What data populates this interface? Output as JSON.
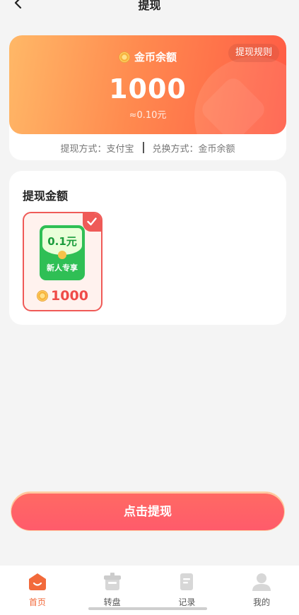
{
  "nav": {
    "title": "提现"
  },
  "balance": {
    "label": "金币余额",
    "rule_button": "提现规则",
    "value": "1000",
    "rmb": "≈0.10元",
    "method": "提现方式：支付宝",
    "exchange": "兑换方式：金币余额"
  },
  "amount": {
    "title": "提现金额",
    "options": [
      {
        "amount": "0.1元",
        "tag": "新人专享",
        "cost": "1000",
        "selected": true
      }
    ]
  },
  "cta": {
    "label": "点击提现"
  },
  "tabs": [
    {
      "label": "首页",
      "icon": "home-icon",
      "active": true
    },
    {
      "label": "转盘",
      "icon": "wheel-icon",
      "active": false
    },
    {
      "label": "记录",
      "icon": "record-icon",
      "active": false
    },
    {
      "label": "我的",
      "icon": "profile-icon",
      "active": false
    }
  ],
  "colors": {
    "accent": "#f26a3b",
    "brand_red": "#ef5a57",
    "green": "#2fbf55"
  }
}
